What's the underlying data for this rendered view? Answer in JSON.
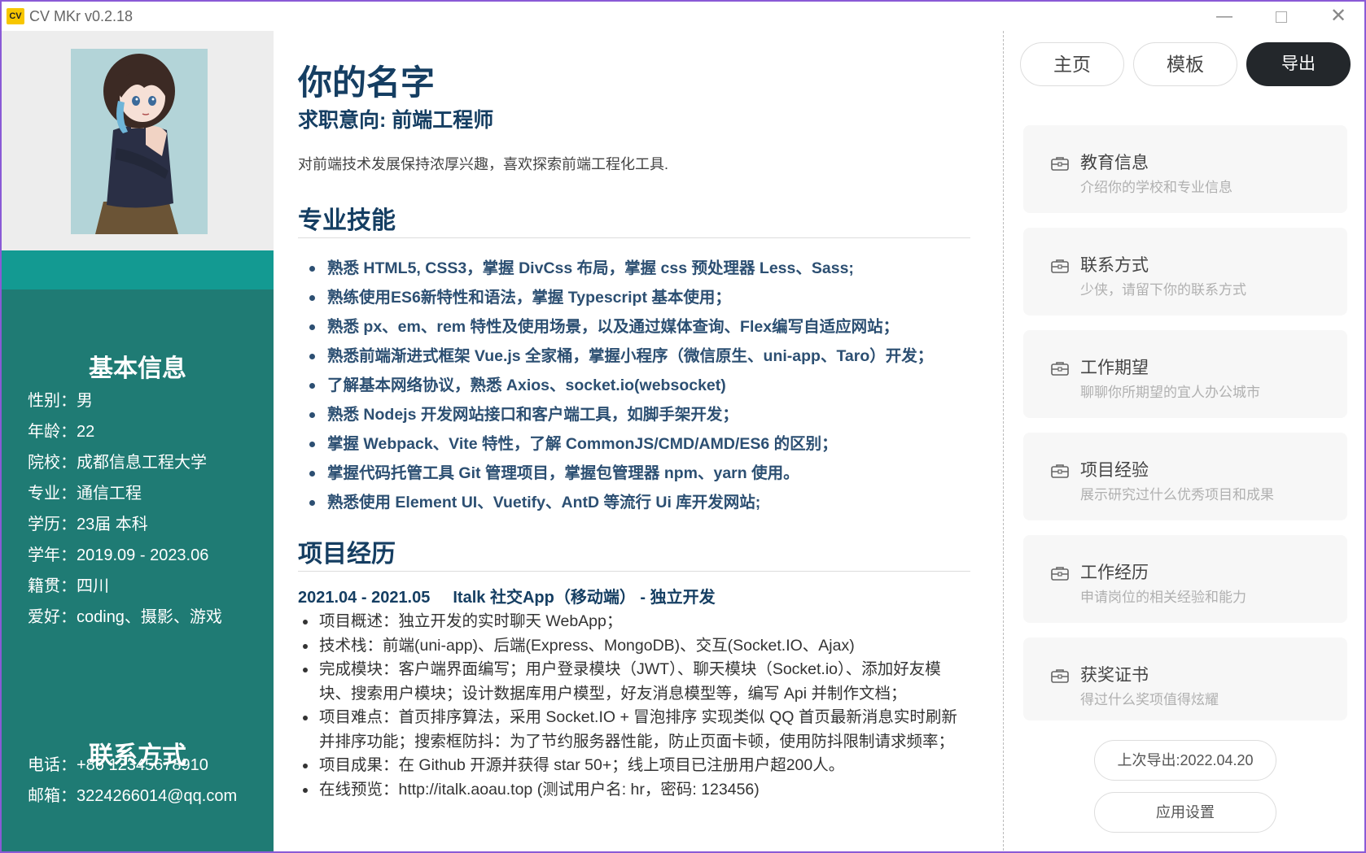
{
  "window": {
    "icon_text": "CV",
    "title": "CV MKr v0.2.18",
    "minimize": "—",
    "close": "✕"
  },
  "sidebar": {
    "basic_title": "基本信息",
    "basic_rows": [
      "性别：男",
      "年龄：22",
      "院校：成都信息工程大学",
      "专业：通信工程",
      "学历：23届 本科",
      "学年：2019.09 - 2023.06",
      "籍贯：四川",
      "爱好：coding、摄影、游戏"
    ],
    "contact_title": "联系方式",
    "contact_rows": [
      "电话：+86 12345678910",
      "邮箱：3224266014@qq.com"
    ]
  },
  "resume": {
    "name": "你的名字",
    "job_intent": "求职意向: 前端工程师",
    "intro": "对前端技术发展保持浓厚兴趣，喜欢探索前端工程化工具.",
    "skills_title": "专业技能",
    "skills": [
      "熟悉 HTML5, CSS3，掌握 DivCss 布局，掌握 css 预处理器 Less、Sass;",
      "熟练使用ES6新特性和语法，掌握 Typescript 基本使用；",
      "熟悉 px、em、rem 特性及使用场景，以及通过媒体查询、Flex编写自适应网站；",
      "熟悉前端渐进式框架 Vue.js 全家桶，掌握小程序（微信原生、uni-app、Taro）开发；",
      "了解基本网络协议，熟悉 Axios、socket.io(websocket)",
      "熟悉 Nodejs 开发网站接口和客户端工具，如脚手架开发；",
      "掌握 Webpack、Vite 特性，了解 CommonJS/CMD/AMD/ES6 的区别；",
      "掌握代码托管工具 Git 管理项目，掌握包管理器 npm、yarn 使用。",
      "熟悉使用 Element UI、Vuetify、AntD 等流行 Ui 库开发网站;"
    ],
    "projects_title": "项目经历",
    "project": {
      "period": "2021.04 - 2021.05",
      "name": "Italk 社交App（移动端） - 独立开发",
      "items": [
        "项目概述：独立开发的实时聊天 WebApp；",
        "技术栈：前端(uni-app)、后端(Express、MongoDB)、交互(Socket.IO、Ajax)",
        "完成模块：客户端界面编写；用户登录模块（JWT）、聊天模块（Socket.io）、添加好友模块、搜索用户模块；设计数据库用户模型，好友消息模型等，编写 Api 并制作文档；",
        "项目难点：首页排序算法，采用 Socket.IO + 冒泡排序 实现类似 QQ 首页最新消息实时刷新并排序功能；搜索框防抖：为了节约服务器性能，防止页面卡顿，使用防抖限制请求频率；",
        "项目成果：在 Github 开源并获得 star 50+；线上项目已注册用户超200人。",
        "在线预览：http://italk.aoau.top (测试用户名: hr，密码: 123456)"
      ]
    }
  },
  "nav": {
    "home": "主页",
    "template": "模板",
    "export": "导出"
  },
  "cards": [
    {
      "title": "教育信息",
      "subtitle": "介绍你的学校和专业信息",
      "icon": "briefcase-icon"
    },
    {
      "title": "联系方式",
      "subtitle": "少侠，请留下你的联系方式",
      "icon": "briefcase-icon"
    },
    {
      "title": "工作期望",
      "subtitle": "聊聊你所期望的宜人办公城市",
      "icon": "briefcase-icon"
    },
    {
      "title": "项目经验",
      "subtitle": "展示研究过什么优秀项目和成果",
      "icon": "briefcase-icon"
    },
    {
      "title": "工作经历",
      "subtitle": "申请岗位的相关经验和能力",
      "icon": "briefcase-icon"
    },
    {
      "title": "获奖证书",
      "subtitle": "得过什么奖项值得炫耀",
      "icon": "briefcase-icon"
    }
  ],
  "footer": {
    "last_export": "上次导出:2022.04.20",
    "settings": "应用设置"
  },
  "colors": {
    "sidebar": "#1f7b74",
    "strip": "#139a92",
    "heading": "#153e62",
    "export_button": "#23272b"
  }
}
